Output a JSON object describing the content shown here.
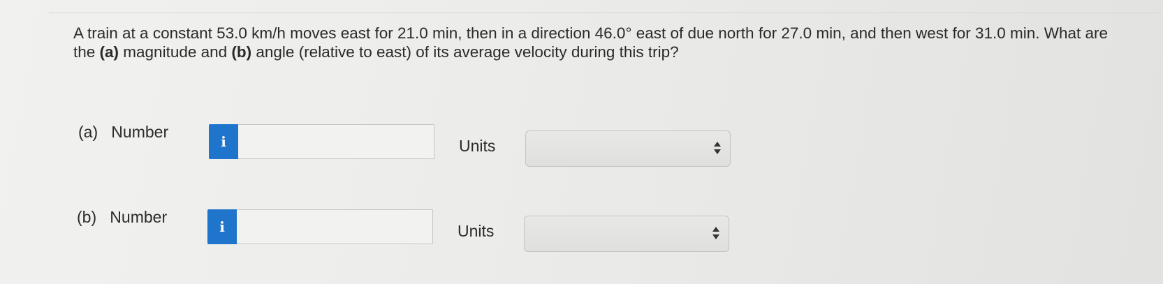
{
  "question": {
    "prefix": "A train at a constant 53.0 km/h moves east for 21.0 min, then in a direction 46.0° east of due north for 27.0 min, and then west for 31.0 min. What are the ",
    "part_a_marker": "(a)",
    "middle": " magnitude and ",
    "part_b_marker": "(b)",
    "suffix": " angle (relative to east) of its average velocity during this trip?"
  },
  "parts": [
    {
      "label": "(a)",
      "number_label": "Number",
      "info_icon": "i",
      "number_value": "",
      "units_label": "Units",
      "units_selected": ""
    },
    {
      "label": "(b)",
      "number_label": "Number",
      "info_icon": "i",
      "number_value": "",
      "units_label": "Units",
      "units_selected": ""
    }
  ],
  "colors": {
    "info_button": "#1f74cc",
    "background": "#ededeb"
  }
}
